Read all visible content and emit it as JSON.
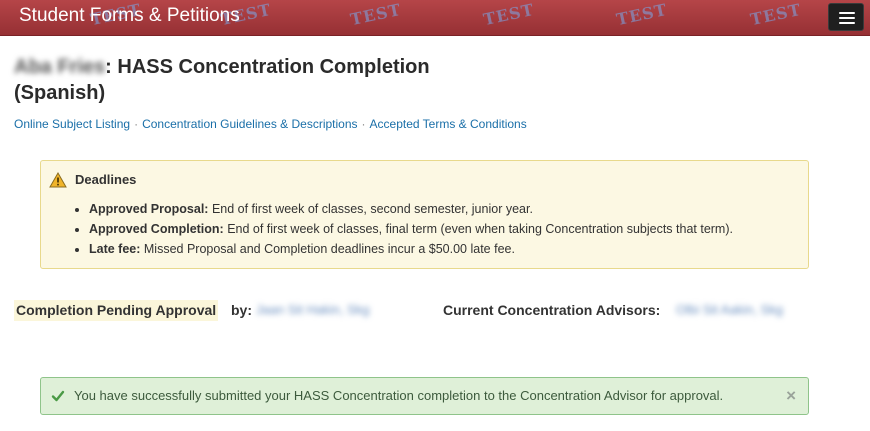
{
  "navbar": {
    "brand": "Student Forms & Petitions",
    "watermark_text": "TEST",
    "menu_icon": "hamburger-menu-icon",
    "background_color": "#a63a3e"
  },
  "header": {
    "name_redacted": "Aba Fries",
    "title_suffix": ": HASS Concentration Completion",
    "title_line2": "(Spanish)"
  },
  "links": [
    "Online Subject Listing",
    "Concentration Guidelines & Descriptions",
    "Accepted Terms & Conditions"
  ],
  "link_separator": "·",
  "deadlines": {
    "icon": "warning-icon",
    "heading": "Deadlines",
    "items": [
      {
        "label": "Approved Proposal:",
        "text": " End of first week of classes, second semester, junior year."
      },
      {
        "label": "Approved Completion:",
        "text": " End of first week of classes, final term (even when taking Concentration subjects that term)."
      },
      {
        "label": "Late fee:",
        "text": " Missed Proposal and Completion deadlines incur a $50.00 late fee."
      }
    ]
  },
  "status": {
    "status_label": "Completion Pending Approval",
    "by_label": "by:",
    "by_value_redacted": "Jaan Sit Hakin, Skg",
    "advisors_label": "Current Concentration Advisors:",
    "advisors_value_redacted": "Olbi Sit Aakin, Skg"
  },
  "success_alert": {
    "icon": "check-icon",
    "message": "You have successfully submitted your HASS Concentration completion to the Concentration Advisor for approval.",
    "close_icon": "close-icon",
    "close_glyph": "×"
  },
  "colors": {
    "link": "#1a6fa8",
    "warning_bg": "#fcf8e3",
    "success_bg": "#dff0d8"
  }
}
